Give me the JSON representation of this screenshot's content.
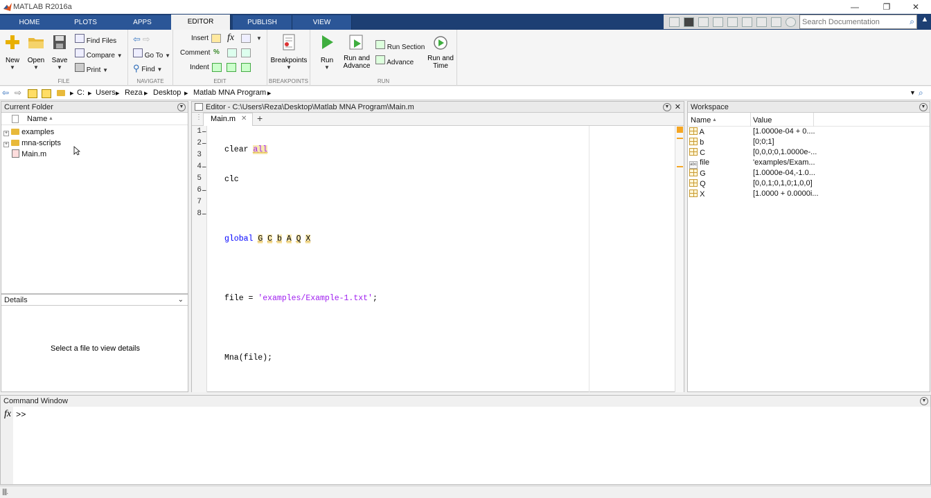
{
  "window": {
    "title": "MATLAB R2016a"
  },
  "tabs": [
    {
      "label": "HOME"
    },
    {
      "label": "PLOTS"
    },
    {
      "label": "APPS"
    },
    {
      "label": "EDITOR"
    },
    {
      "label": "PUBLISH"
    },
    {
      "label": "VIEW"
    }
  ],
  "search": {
    "placeholder": "Search Documentation"
  },
  "ribbon": {
    "file": {
      "name": "FILE",
      "new": "New",
      "open": "Open",
      "save": "Save",
      "find_files": "Find Files",
      "compare": "Compare",
      "print": "Print"
    },
    "navigate": {
      "name": "NAVIGATE",
      "go_to": "Go To",
      "find": "Find"
    },
    "edit": {
      "name": "EDIT",
      "insert": "Insert",
      "comment": "Comment",
      "indent": "Indent"
    },
    "breakpoints": {
      "name": "BREAKPOINTS",
      "breakpoints": "Breakpoints"
    },
    "run": {
      "name": "RUN",
      "run": "Run",
      "run_and_advance_1": "Run and",
      "run_and_advance_2": "Advance",
      "run_section": "Run Section",
      "advance": "Advance",
      "run_and_time_1": "Run and",
      "run_and_time_2": "Time"
    }
  },
  "address": {
    "crumbs": [
      "C:",
      "Users",
      "Reza",
      "Desktop",
      "Matlab MNA Program"
    ]
  },
  "current_folder": {
    "title": "Current Folder",
    "column": "Name",
    "items": [
      {
        "name": "examples",
        "type": "folder"
      },
      {
        "name": "mna-scripts",
        "type": "folder"
      },
      {
        "name": "Main.m",
        "type": "file"
      }
    ]
  },
  "details": {
    "title": "Details",
    "message": "Select a file to view details"
  },
  "editor": {
    "title": "Editor - C:\\Users\\Reza\\Desktop\\Matlab MNA Program\\Main.m",
    "tab": "Main.m",
    "lines": [
      {
        "n": "1",
        "mark": "–"
      },
      {
        "n": "2",
        "mark": "–"
      },
      {
        "n": "3",
        "mark": ""
      },
      {
        "n": "4",
        "mark": "–"
      },
      {
        "n": "5",
        "mark": ""
      },
      {
        "n": "6",
        "mark": "–"
      },
      {
        "n": "7",
        "mark": ""
      },
      {
        "n": "8",
        "mark": "–"
      }
    ],
    "code": {
      "l1_a": "clear ",
      "l1_b": "all",
      "l2": "clc",
      "l4_kw": "global ",
      "l4_vars": [
        "G",
        "C",
        "b",
        "A",
        "Q",
        "X"
      ],
      "l6_a": "file = ",
      "l6_b": "'examples/Example-1.txt'",
      "l6_c": ";",
      "l8": "Mna(file);"
    }
  },
  "workspace": {
    "title": "Workspace",
    "col_name": "Name",
    "col_value": "Value",
    "rows": [
      {
        "name": "A",
        "value": "[1.0000e-04 + 0....",
        "icon": "grid-icon"
      },
      {
        "name": "b",
        "value": "[0;0;1]",
        "icon": "grid-icon"
      },
      {
        "name": "C",
        "value": "[0,0,0;0,1.0000e-...",
        "icon": "grid-icon"
      },
      {
        "name": "file",
        "value": "'examples/Exam...",
        "icon": "char-icon"
      },
      {
        "name": "G",
        "value": "[1.0000e-04,-1.0...",
        "icon": "grid-icon"
      },
      {
        "name": "Q",
        "value": "[0,0,1;0,1,0;1,0,0]",
        "icon": "grid-icon"
      },
      {
        "name": "X",
        "value": "[1.0000 + 0.0000i...",
        "icon": "grid-icon"
      }
    ]
  },
  "command_window": {
    "title": "Command Window",
    "fx": "fx",
    "prompt": ">>"
  },
  "colors": {
    "tab_bar": "#1d3f73",
    "keyword": "#0000ff",
    "string": "#a020f0"
  }
}
